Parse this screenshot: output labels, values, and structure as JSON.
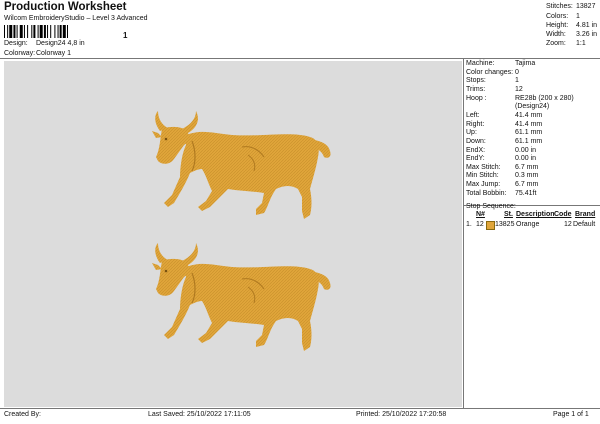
{
  "header": {
    "title": "Production Worksheet",
    "subtitle": "Wilcom EmbroideryStudio – Level 3 Advanced",
    "barcode_text": "1",
    "design_label": "Design:",
    "design_value": "Design24 4,8 in",
    "colorway_label": "Colorway:",
    "colorway_value": "Colorway 1"
  },
  "stats": {
    "stitches_label": "Stitches:",
    "stitches_value": "13827",
    "colors_label": "Colors:",
    "colors_value": "1",
    "height_label": "Height:",
    "height_value": "4.81 in",
    "width_label": "Width:",
    "width_value": "3.26 in",
    "zoom_label": "Zoom:",
    "zoom_value": "1:1"
  },
  "machine_info": [
    {
      "label": "Machine:",
      "value": "Tajima"
    },
    {
      "label": "Color changes:",
      "value": "0"
    },
    {
      "label": "Stops:",
      "value": "1"
    },
    {
      "label": "Trims:",
      "value": "12"
    },
    {
      "label": "Hoop :",
      "value": "RE28b (200 x 280)"
    },
    {
      "label": "",
      "value": "(Design24)"
    },
    {
      "label": "Left:",
      "value": "41.4 mm"
    },
    {
      "label": "Right:",
      "value": "41.4 mm"
    },
    {
      "label": "Up:",
      "value": "61.1 mm"
    },
    {
      "label": "Down:",
      "value": "61.1 mm"
    },
    {
      "label": "EndX:",
      "value": "0.00 in"
    },
    {
      "label": "EndY:",
      "value": "0.00 in"
    },
    {
      "label": "Max Stitch:",
      "value": "6.7 mm"
    },
    {
      "label": "Min Stitch:",
      "value": "0.3 mm"
    },
    {
      "label": "Max Jump:",
      "value": "6.7 mm"
    },
    {
      "label": "Total Bobbin:",
      "value": "75.41ft"
    }
  ],
  "stop_sequence": {
    "title": "Stop Sequence:",
    "headers": {
      "n": "N#",
      "st": "St.",
      "description": "Description",
      "code": "Code",
      "brand": "Brand"
    },
    "rows": [
      {
        "index": "1.",
        "n": "12",
        "st": "13825",
        "description": "Orange",
        "code": "12",
        "brand": "Default",
        "color": "#E0A53A"
      }
    ]
  },
  "footer": {
    "created_by": "Created By:",
    "last_saved": "Last Saved: 25/10/2022 17:11:05",
    "printed": "Printed: 25/10/2022 17:20:58",
    "page": "Page 1 of 1"
  },
  "colors": {
    "thread": "#E0A53A",
    "thread_dark": "#C28A26",
    "canvas_bg": "#DCDCDC"
  }
}
